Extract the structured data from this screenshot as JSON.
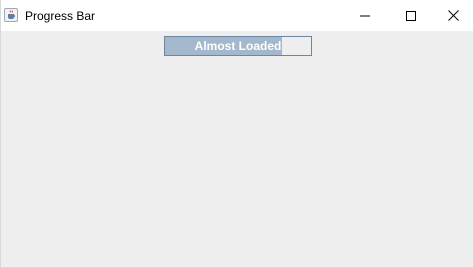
{
  "window": {
    "title": "Progress Bar",
    "app_icon": "java-coffee-cup-icon",
    "controls": {
      "minimize_icon": "minimize-icon",
      "maximize_icon": "maximize-icon",
      "close_icon": "close-icon"
    }
  },
  "progress": {
    "label": "Almost Loaded",
    "value_fraction": 0.8,
    "colors": {
      "fill": "#a3b8cc",
      "track": "#eeeeee",
      "border": "#6d86a1",
      "text": "#ffffff"
    }
  },
  "colors": {
    "window_bg": "#eeeeee",
    "titlebar_bg": "#ffffff"
  }
}
